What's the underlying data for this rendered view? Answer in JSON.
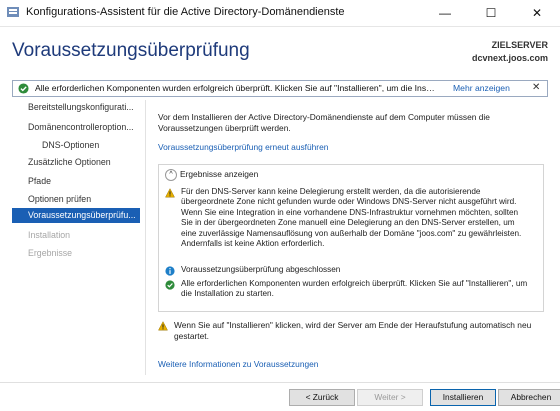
{
  "window": {
    "title": "Konfigurations-Assistent für die Active Directory-Domänendienste",
    "minimize": "—",
    "maximize": "☐",
    "close": "✕"
  },
  "header": {
    "page_title": "Voraussetzungsüberprüfung",
    "server_label": "ZIELSERVER",
    "server_name": "dcvnext.joos.com"
  },
  "notification": {
    "text": "Alle erforderlichen Komponenten wurden erfolgreich überprüft. Klicken Sie auf \"Installieren\", um die Inst...",
    "more_link": "Mehr anzeigen",
    "close": "✕",
    "icon": "check-circle-icon"
  },
  "nav": {
    "items": [
      {
        "label": "Bereitstellungskonfigurati...",
        "state": "normal"
      },
      {
        "label": "Domänencontrolleroption...",
        "state": "normal"
      },
      {
        "label": "DNS-Optionen",
        "state": "sub"
      },
      {
        "label": "Zusätzliche Optionen",
        "state": "normal"
      },
      {
        "label": "Pfade",
        "state": "normal"
      },
      {
        "label": "Optionen prüfen",
        "state": "normal"
      },
      {
        "label": "Voraussetzungsüberprüfu...",
        "state": "active"
      },
      {
        "label": "Installation",
        "state": "disabled"
      },
      {
        "label": "Ergebnisse",
        "state": "disabled"
      }
    ]
  },
  "content": {
    "intro": "Vor dem Installieren der Active Directory-Domänendienste auf dem Computer müssen die Voraussetzungen überprüft werden.",
    "rerun_link": "Voraussetzungsüberprüfung erneut ausführen",
    "results_header": "Ergebnisse anzeigen",
    "results": [
      {
        "icon": "warning-icon",
        "text": "Für den DNS-Server kann keine Delegierung erstellt werden, da die autorisierende übergeordnete Zone nicht gefunden wurde oder Windows DNS-Server nicht ausgeführt wird. Wenn Sie eine Integration in eine vorhandene DNS-Infrastruktur vornehmen möchten, sollten Sie in der übergeordneten Zone manuell eine Delegierung an den DNS-Server erstellen, um eine zuverlässige Namensauflösung von außerhalb der Domäne \"joos.com\" zu gewährleisten. Andernfalls ist keine Aktion erforderlich."
      },
      {
        "icon": "info-icon",
        "text": "Voraussetzungsüberprüfung abgeschlossen"
      },
      {
        "icon": "check-circle-icon",
        "text": "Alle erforderlichen Komponenten wurden erfolgreich überprüft. Klicken Sie auf \"Installieren\", um die Installation zu starten."
      }
    ],
    "footer_warning": "Wenn Sie auf \"Installieren\" klicken, wird der Server am Ende der Heraufstufung automatisch neu gestartet.",
    "more_info_link": "Weitere Informationen zu Voraussetzungen"
  },
  "buttons": {
    "back": "< Zurück",
    "next": "Weiter >",
    "install": "Installieren",
    "cancel": "Abbrechen"
  },
  "colors": {
    "accent": "#1a5fb4",
    "title": "#1e3a7a",
    "success": "#2e8b3a",
    "warning": "#e8b100",
    "info": "#1e7fc8"
  }
}
